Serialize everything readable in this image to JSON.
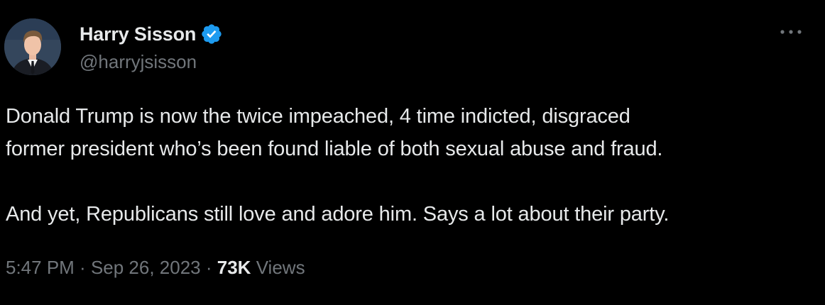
{
  "author": {
    "display_name": "Harry Sisson",
    "handle": "@harryjsisson",
    "verified": true
  },
  "tweet": {
    "paragraphs": [
      "Donald Trump is now the twice impeached, 4 time indicted, disgraced\nformer president who’s been found liable of both sexual abuse and fraud.",
      "And yet, Republicans still love and adore him. Says a lot about their party."
    ],
    "time": "5:47 PM",
    "date": "Sep 26, 2023",
    "separator": " · ",
    "views_count": "73K",
    "views_label": "Views"
  },
  "icons": {
    "verified": "verified-badge-icon",
    "more": "more-options-icon"
  },
  "colors": {
    "background": "#000000",
    "primary_text": "#e7e9ea",
    "secondary_text": "#71767b",
    "verified_blue": "#1d9bf0"
  }
}
